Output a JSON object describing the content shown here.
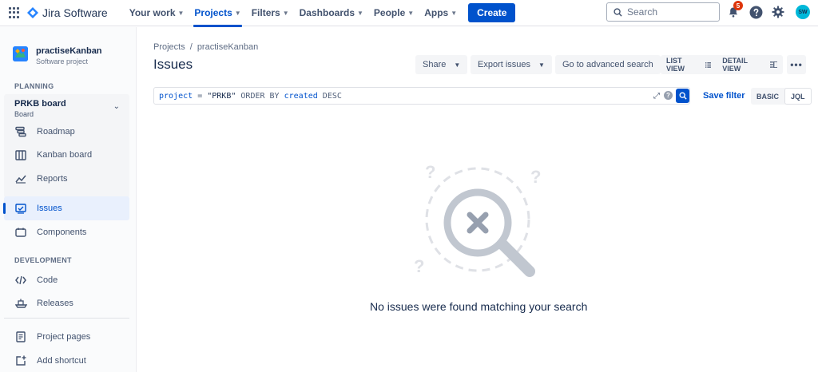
{
  "topnav": {
    "app_name": "Jira Software",
    "items": [
      {
        "label": "Your work",
        "has_chevron": true,
        "active": false
      },
      {
        "label": "Projects",
        "has_chevron": true,
        "active": true
      },
      {
        "label": "Filters",
        "has_chevron": true,
        "active": false
      },
      {
        "label": "Dashboards",
        "has_chevron": true,
        "active": false
      },
      {
        "label": "People",
        "has_chevron": true,
        "active": false
      },
      {
        "label": "Apps",
        "has_chevron": true,
        "active": false
      }
    ],
    "create_label": "Create",
    "search_placeholder": "Search",
    "notification_count": "5",
    "avatar_initials": "SW",
    "icons": [
      "app-switcher-icon",
      "jira-logo-icon",
      "search-icon",
      "notification-icon",
      "help-icon",
      "settings-icon"
    ]
  },
  "sidebar": {
    "project_name": "practiseKanban",
    "project_type": "Software project",
    "planning_label": "PLANNING",
    "board_name": "PRKB board",
    "board_type": "Board",
    "planning_items": [
      {
        "label": "Roadmap",
        "icon": "roadmap-icon"
      },
      {
        "label": "Kanban board",
        "icon": "board-icon"
      },
      {
        "label": "Reports",
        "icon": "reports-icon"
      }
    ],
    "issues_label": "Issues",
    "components_label": "Components",
    "development_label": "DEVELOPMENT",
    "dev_items": [
      {
        "label": "Code",
        "icon": "code-icon"
      },
      {
        "label": "Releases",
        "icon": "releases-icon"
      }
    ],
    "project_pages_label": "Project pages",
    "add_shortcut_label": "Add shortcut"
  },
  "main": {
    "breadcrumb": [
      "Projects",
      "practiseKanban"
    ],
    "breadcrumb_sep": "/",
    "title": "Issues",
    "share_label": "Share",
    "export_label": "Export issues",
    "advanced_search_label": "Go to advanced search",
    "list_view_label": "LIST VIEW",
    "detail_view_label": "DETAIL VIEW",
    "more_label": "•••",
    "jql": {
      "field": "project",
      "op": "=",
      "value": "\"PRKB\"",
      "order": "ORDER BY",
      "order_field": "created",
      "direction": "DESC"
    },
    "help_label": "?",
    "save_filter_label": "Save filter",
    "basic_label": "BASIC",
    "jql_label": "JQL",
    "empty_message": "No issues were found matching your search"
  },
  "colors": {
    "brand": "#0052cc",
    "text": "#172b4d",
    "subtle": "#42526e",
    "badge": "#de350b",
    "avatar": "#00b8d9"
  }
}
